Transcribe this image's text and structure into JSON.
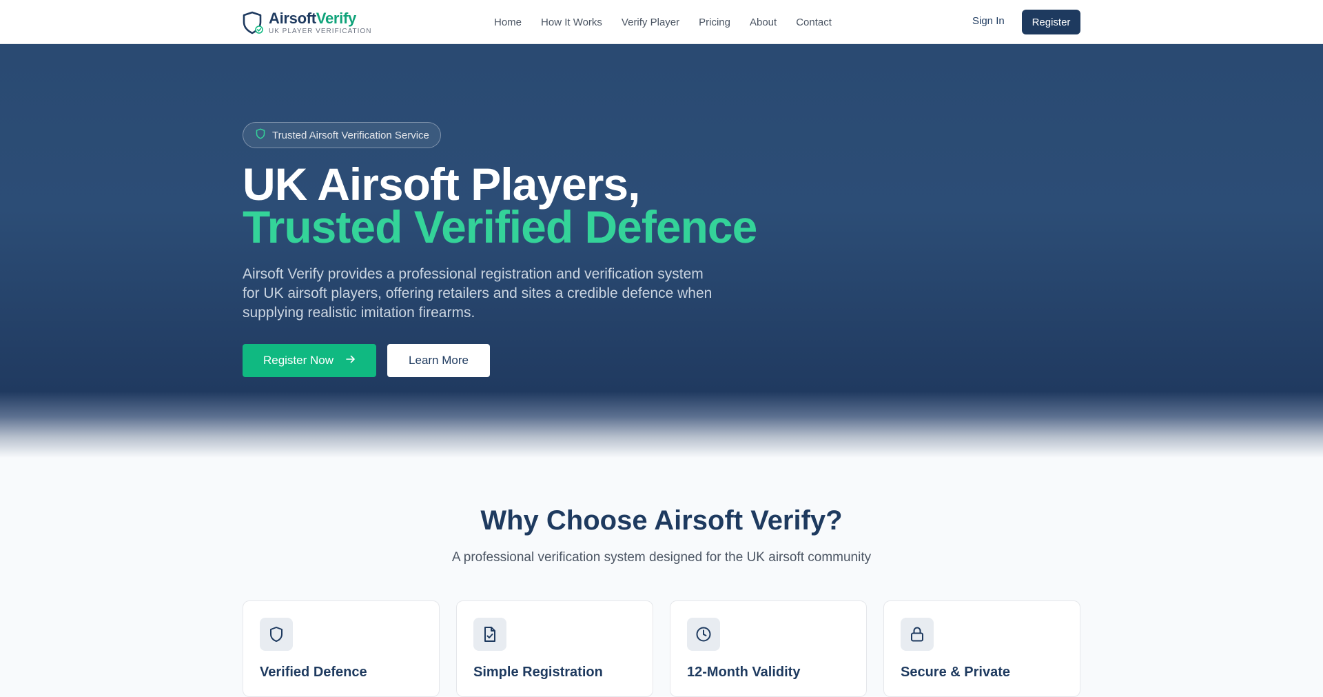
{
  "brand": {
    "name_part1": "Airsoft",
    "name_part2": "Verify",
    "tagline": "UK PLAYER VERIFICATION",
    "primary_color": "#1e3a5f",
    "accent_color": "#10b981"
  },
  "nav": {
    "links": [
      "Home",
      "How It Works",
      "Verify Player",
      "Pricing",
      "About",
      "Contact"
    ],
    "signin_label": "Sign In",
    "register_label": "Register"
  },
  "hero": {
    "badge_icon": "shield-icon",
    "badge_text": "Trusted Airsoft Verification Service",
    "title_line1": "UK Airsoft Players,",
    "title_line2": "Trusted Verified Defence",
    "description": "Airsoft Verify provides a professional registration and verification system for UK airsoft players, offering retailers and sites a credible defence when supplying realistic imitation firearms.",
    "primary_cta": "Register Now",
    "primary_cta_icon": "arrow-right-icon",
    "secondary_cta": "Learn More"
  },
  "features": {
    "title": "Why Choose Airsoft Verify?",
    "subtitle": "A professional verification system designed for the UK airsoft community",
    "cards": [
      {
        "icon": "shield-icon",
        "title": "Verified Defence"
      },
      {
        "icon": "file-check-icon",
        "title": "Simple Registration"
      },
      {
        "icon": "clock-icon",
        "title": "12-Month Validity"
      },
      {
        "icon": "lock-icon",
        "title": "Secure & Private"
      }
    ]
  }
}
